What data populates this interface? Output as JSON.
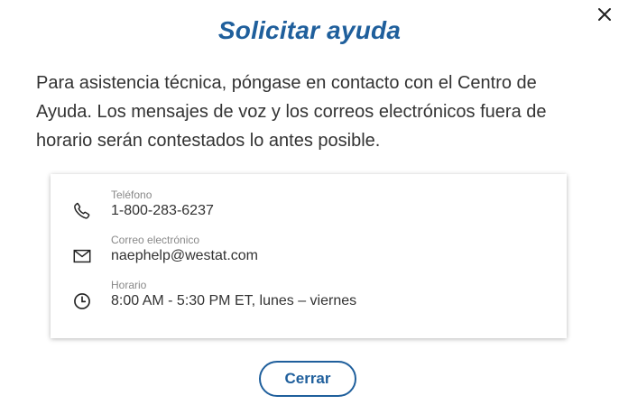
{
  "dialog": {
    "title": "Solicitar ayuda",
    "intro": "Para asistencia técnica, póngase en contacto con el Centro de Ayuda. Los mensajes de voz y los correos electrónicos fuera de horario serán contestados lo antes posible.",
    "close_icon": "close-icon",
    "close_button_label": "Cerrar"
  },
  "contact": {
    "phone": {
      "icon": "phone-icon",
      "label": "Teléfono",
      "value": "1-800-283-6237"
    },
    "email": {
      "icon": "mail-icon",
      "label": "Correo electrónico",
      "value": "naephelp@westat.com"
    },
    "hours": {
      "icon": "clock-icon",
      "label": "Horario",
      "value": "8:00 AM - 5:30 PM ET, lunes – viernes"
    }
  },
  "colors": {
    "accent": "#1f5f9c",
    "text": "#333333",
    "muted": "#888888"
  }
}
